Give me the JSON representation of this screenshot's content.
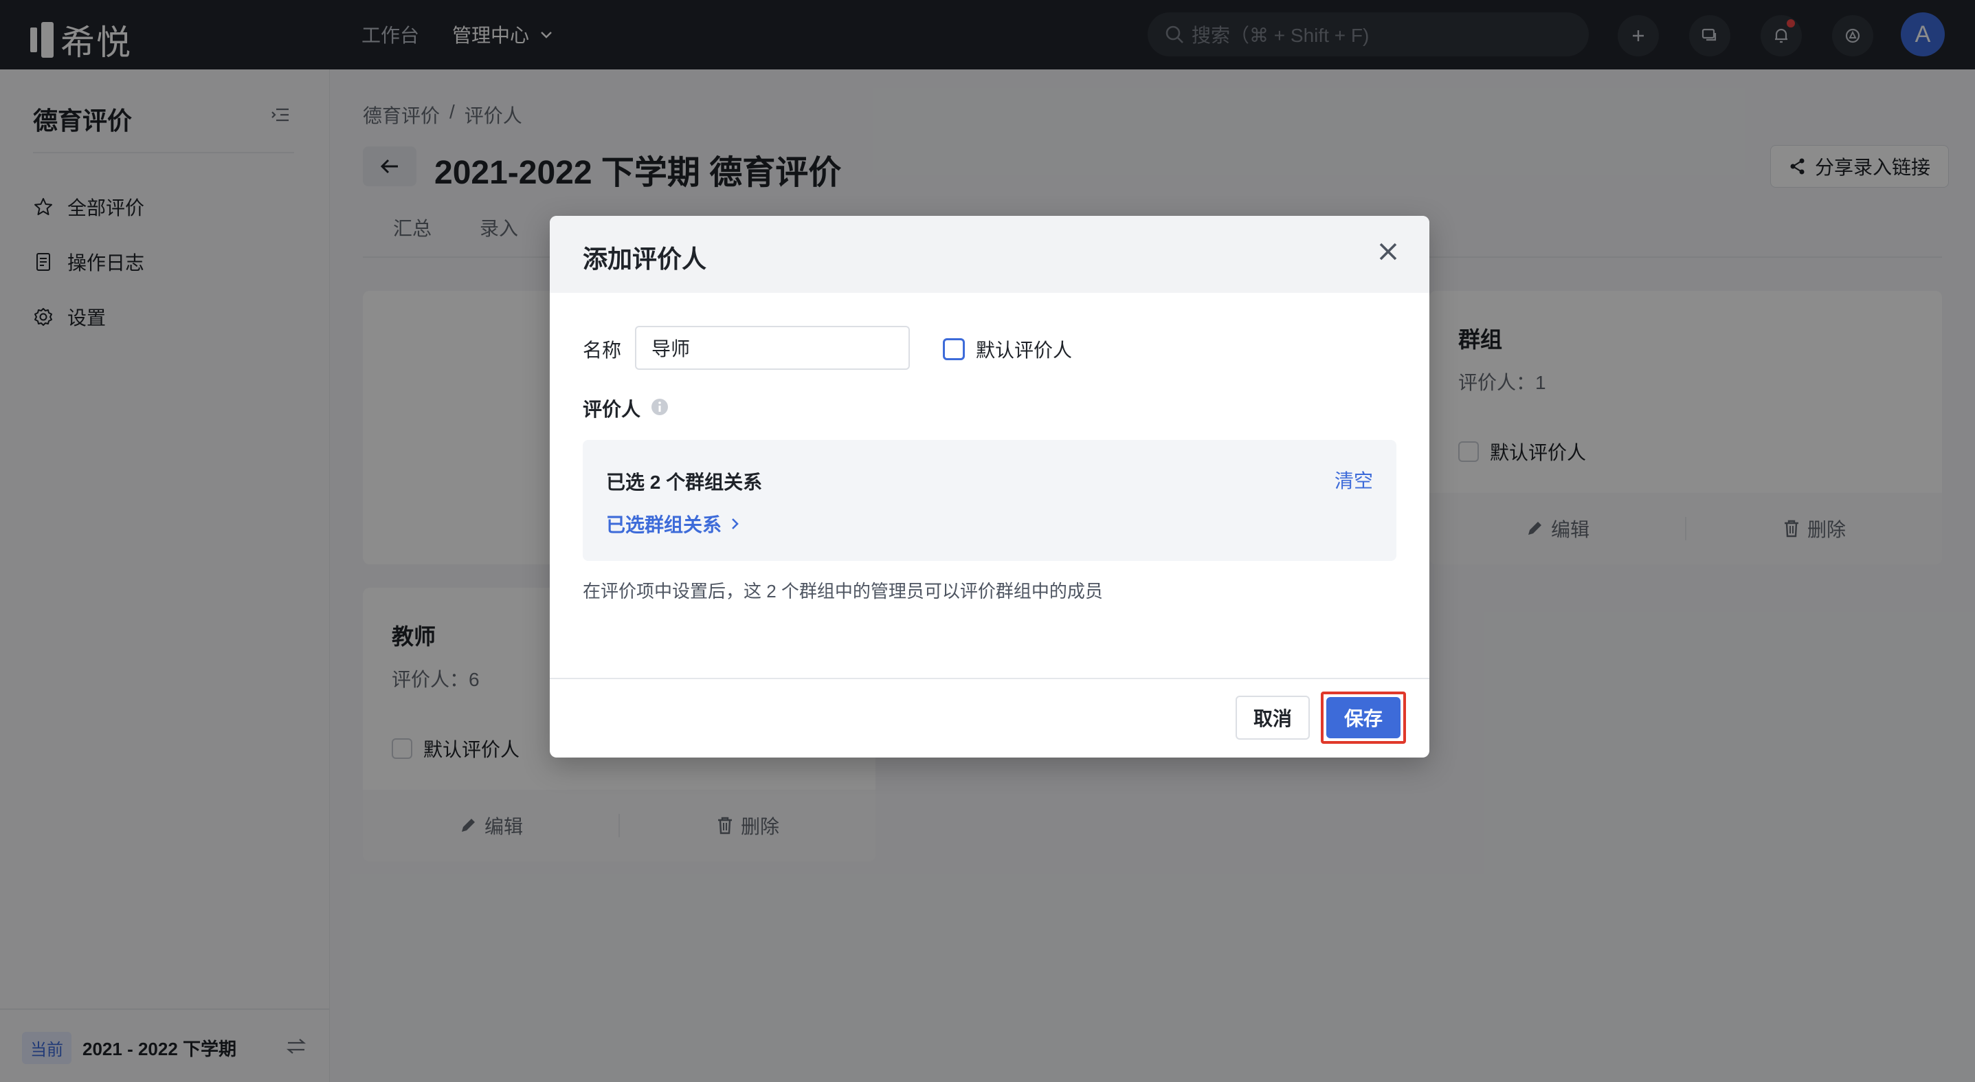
{
  "app": {
    "logo_text": "希悦"
  },
  "topnav": {
    "items": [
      {
        "label": "工作台"
      },
      {
        "label": "管理中心"
      }
    ],
    "search_placeholder": "搜索（⌘ + Shift + F)",
    "avatar_initial": "A"
  },
  "sidebar": {
    "title": "德育评价",
    "items": [
      {
        "label": "全部评价",
        "icon": "star-icon"
      },
      {
        "label": "操作日志",
        "icon": "document-icon"
      },
      {
        "label": "设置",
        "icon": "gear-icon"
      }
    ],
    "term_tag": "当前",
    "term_text": "2021 - 2022 下学期"
  },
  "breadcrumb": {
    "root": "德育评价",
    "separator": "/",
    "current": "评价人"
  },
  "page": {
    "title": "2021-2022 下学期 德育评价",
    "share_label": "分享录入链接",
    "tabs": [
      {
        "label": "汇总"
      },
      {
        "label": "录入"
      }
    ]
  },
  "cards": [
    {
      "title": "群组",
      "count": "评价人：1",
      "default_label": "默认评价人",
      "edit": "编辑",
      "delete": "删除"
    },
    {
      "title": "教师",
      "count": "评价人：6",
      "default_label": "默认评价人",
      "edit": "编辑",
      "delete": "删除"
    }
  ],
  "modal": {
    "title": "添加评价人",
    "name_label": "名称",
    "name_value": "导师",
    "default_label": "默认评价人",
    "evaluator_label": "评价人",
    "selected_count": "已选 2 个群组关系",
    "clear_label": "清空",
    "selected_link": "已选群组关系",
    "hint": "在评价项中设置后，这 2 个群组中的管理员可以评价群组中的成员",
    "cancel_label": "取消",
    "save_label": "保存"
  },
  "colors": {
    "accent": "#3d6bd9",
    "highlight": "#e0392b",
    "topbar": "#22252c"
  }
}
